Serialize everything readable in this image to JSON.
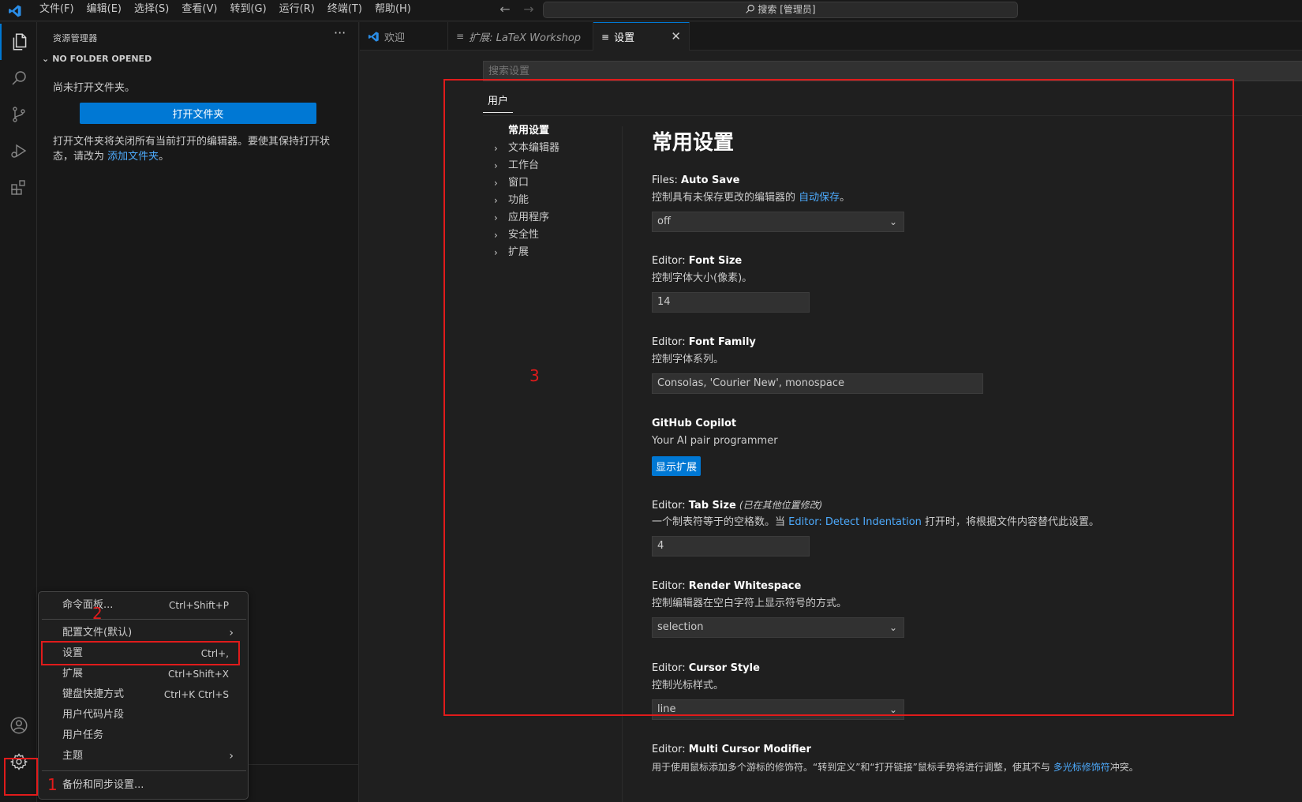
{
  "titlebar": {
    "menus": [
      "文件(F)",
      "编辑(E)",
      "选择(S)",
      "查看(V)",
      "转到(G)",
      "运行(R)",
      "终端(T)",
      "帮助(H)"
    ],
    "back": "←",
    "forward": "→",
    "search_label": "搜索 [管理员]"
  },
  "sidebar": {
    "title": "资源管理器",
    "more": "···",
    "folder_header": "NO FOLDER OPENED",
    "no_folder_msg": "尚未打开文件夹。",
    "open_folder_btn": "打开文件夹",
    "desc_text": "打开文件夹将关闭所有当前打开的编辑器。要使其保持打开状态，请改为 ",
    "desc_link": "添加文件夹",
    "desc_end": "。"
  },
  "tabs": [
    {
      "label": "欢迎",
      "icon": "vscode-icon"
    },
    {
      "label": "扩展: LaTeX Workshop",
      "icon": "list-icon"
    },
    {
      "label": "设置",
      "icon": "list-icon",
      "close": "✕"
    }
  ],
  "settings": {
    "search_placeholder": "搜索设置",
    "scope_tab": "用户",
    "toc": {
      "head": "常用设置",
      "items": [
        "文本编辑器",
        "工作台",
        "窗口",
        "功能",
        "应用程序",
        "安全性",
        "扩展"
      ]
    },
    "section_title": "常用设置",
    "items": [
      {
        "category": "Files: ",
        "name": "Auto Save",
        "desc": "控制具有未保存更改的编辑器的 ",
        "desc_link": "自动保存",
        "desc_end": "。",
        "value": "off"
      },
      {
        "category": "Editor: ",
        "name": "Font Size",
        "desc": "控制字体大小(像素)。",
        "value": "14"
      },
      {
        "category": "Editor: ",
        "name": "Font Family",
        "desc": "控制字体系列。",
        "value": "Consolas, 'Courier New', monospace"
      },
      {
        "category": "",
        "name": "GitHub Copilot",
        "desc": "Your AI pair programmer",
        "button": "显示扩展"
      },
      {
        "category": "Editor: ",
        "name": "Tab Size",
        "modified": "(已在其他位置修改)",
        "desc": "一个制表符等于的空格数。当 ",
        "desc_link": "Editor: Detect Indentation",
        "desc_end": " 打开时，将根据文件内容替代此设置。",
        "value": "4"
      },
      {
        "category": "Editor: ",
        "name": "Render Whitespace",
        "desc": "控制编辑器在空白字符上显示符号的方式。",
        "value": "selection"
      },
      {
        "category": "Editor: ",
        "name": "Cursor Style",
        "desc": "控制光标样式。",
        "value": "line"
      },
      {
        "category": "Editor: ",
        "name": "Multi Cursor Modifier",
        "desc": "用于使用鼠标添加多个游标的修饰符。“转到定义”和“打开链接”鼠标手势将进行调整，使其不与 ",
        "desc_link": "多光标修饰符",
        "desc_end": "冲突。"
      }
    ]
  },
  "context_menu": {
    "items": [
      {
        "label": "命令面板...",
        "kb": "Ctrl+Shift+P"
      },
      {
        "label": "配置文件(默认)",
        "submenu": "›"
      },
      {
        "label": "设置",
        "kb": "Ctrl+,"
      },
      {
        "label": "扩展",
        "kb": "Ctrl+Shift+X"
      },
      {
        "label": "键盘快捷方式",
        "kb": "Ctrl+K Ctrl+S"
      },
      {
        "label": "用户代码片段"
      },
      {
        "label": "用户任务"
      },
      {
        "label": "主题",
        "submenu": "›"
      },
      {
        "label": "备份和同步设置..."
      }
    ]
  },
  "annotations": [
    "1",
    "2",
    "3"
  ],
  "colors": {
    "accent": "#0078d4",
    "annotation_red": "#e01b1b",
    "link": "#4daafc"
  }
}
